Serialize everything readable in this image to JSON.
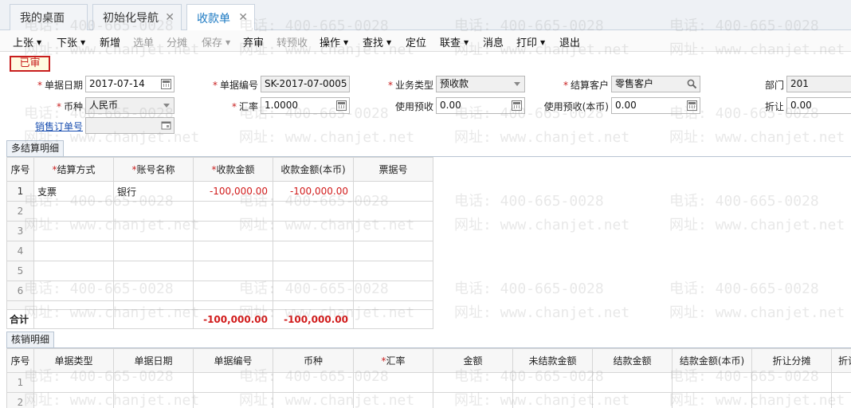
{
  "tabs": [
    {
      "label": "我的桌面",
      "closable": false,
      "active": false
    },
    {
      "label": "初始化导航",
      "closable": true,
      "active": false
    },
    {
      "label": "收款单",
      "closable": true,
      "active": true
    }
  ],
  "toolbar": [
    {
      "label": "上张",
      "dropdown": true,
      "disabled": false
    },
    {
      "label": "下张",
      "dropdown": true,
      "disabled": false
    },
    {
      "label": "新增",
      "dropdown": false,
      "disabled": false
    },
    {
      "label": "选单",
      "dropdown": false,
      "disabled": true
    },
    {
      "label": "分摊",
      "dropdown": false,
      "disabled": true
    },
    {
      "label": "保存",
      "dropdown": true,
      "disabled": true
    },
    {
      "label": "弃审",
      "dropdown": false,
      "disabled": false
    },
    {
      "label": "转预收",
      "dropdown": false,
      "disabled": true
    },
    {
      "label": "操作",
      "dropdown": true,
      "disabled": false
    },
    {
      "label": "查找",
      "dropdown": true,
      "disabled": false
    },
    {
      "label": "定位",
      "dropdown": false,
      "disabled": false
    },
    {
      "label": "联查",
      "dropdown": true,
      "disabled": false
    },
    {
      "label": "消息",
      "dropdown": false,
      "disabled": false
    },
    {
      "label": "打印",
      "dropdown": true,
      "disabled": false
    },
    {
      "label": "退出",
      "dropdown": false,
      "disabled": false
    }
  ],
  "status_stamp": "已审",
  "form": {
    "doc_date": {
      "label": "单据日期",
      "value": "2017-07-14"
    },
    "doc_no": {
      "label": "单据编号",
      "value": "SK-2017-07-0005"
    },
    "biz_type": {
      "label": "业务类型",
      "value": "预收款"
    },
    "customer": {
      "label": "结算客户",
      "value": "零售客户"
    },
    "dept": {
      "label": "部门",
      "value": "201"
    },
    "currency": {
      "label": "币种",
      "value": "人民币"
    },
    "rate": {
      "label": "汇率",
      "value": "1.0000"
    },
    "use_prepay": {
      "label": "使用预收",
      "value": "0.00"
    },
    "use_prepay_local": {
      "label": "使用预收(本币)",
      "value": "0.00"
    },
    "discount": {
      "label": "折让",
      "value": "0.00"
    },
    "sales_order": {
      "label": "销售订单号",
      "value": ""
    }
  },
  "settle_section": {
    "title": "多结算明细",
    "headers": [
      "序号",
      "结算方式",
      "账号名称",
      "收款金额",
      "收款金额(本币)",
      "票据号"
    ],
    "rows": [
      {
        "no": "1",
        "method": "支票",
        "account": "银行",
        "amount": "-100,000.00",
        "amount_local": "-100,000.00",
        "bill_no": ""
      },
      {
        "no": "2",
        "method": "",
        "account": "",
        "amount": "",
        "amount_local": "",
        "bill_no": ""
      },
      {
        "no": "3",
        "method": "",
        "account": "",
        "amount": "",
        "amount_local": "",
        "bill_no": ""
      },
      {
        "no": "4",
        "method": "",
        "account": "",
        "amount": "",
        "amount_local": "",
        "bill_no": ""
      },
      {
        "no": "5",
        "method": "",
        "account": "",
        "amount": "",
        "amount_local": "",
        "bill_no": ""
      },
      {
        "no": "6",
        "method": "",
        "account": "",
        "amount": "",
        "amount_local": "",
        "bill_no": ""
      }
    ],
    "total": {
      "label": "合计",
      "amount": "-100,000.00",
      "amount_local": "-100,000.00"
    }
  },
  "verify_section": {
    "title": "核销明细",
    "headers": [
      "序号",
      "单据类型",
      "单据日期",
      "单据编号",
      "币种",
      "汇率",
      "金额",
      "未结款金额",
      "结款金额",
      "结款金额(本币)",
      "折让分摊",
      "折让"
    ],
    "rows": [
      {
        "no": "1"
      },
      {
        "no": "2"
      }
    ]
  },
  "watermark": {
    "phone": "电话: 400-665-0028",
    "site": "网址: www.chanjet.net"
  },
  "colors": {
    "accent": "#1a78c2",
    "stamp": "#c81e1e",
    "negative": "#d11a1a"
  }
}
